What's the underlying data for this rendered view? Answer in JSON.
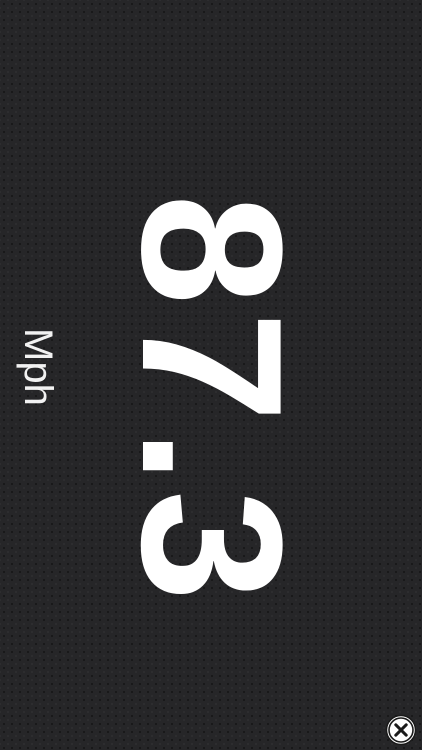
{
  "speedometer": {
    "speed_value": "87.3",
    "unit_label": "Mph"
  },
  "controls": {
    "close_icon": "close-circle-icon"
  },
  "colors": {
    "background": "#262628",
    "text": "#ffffff"
  }
}
